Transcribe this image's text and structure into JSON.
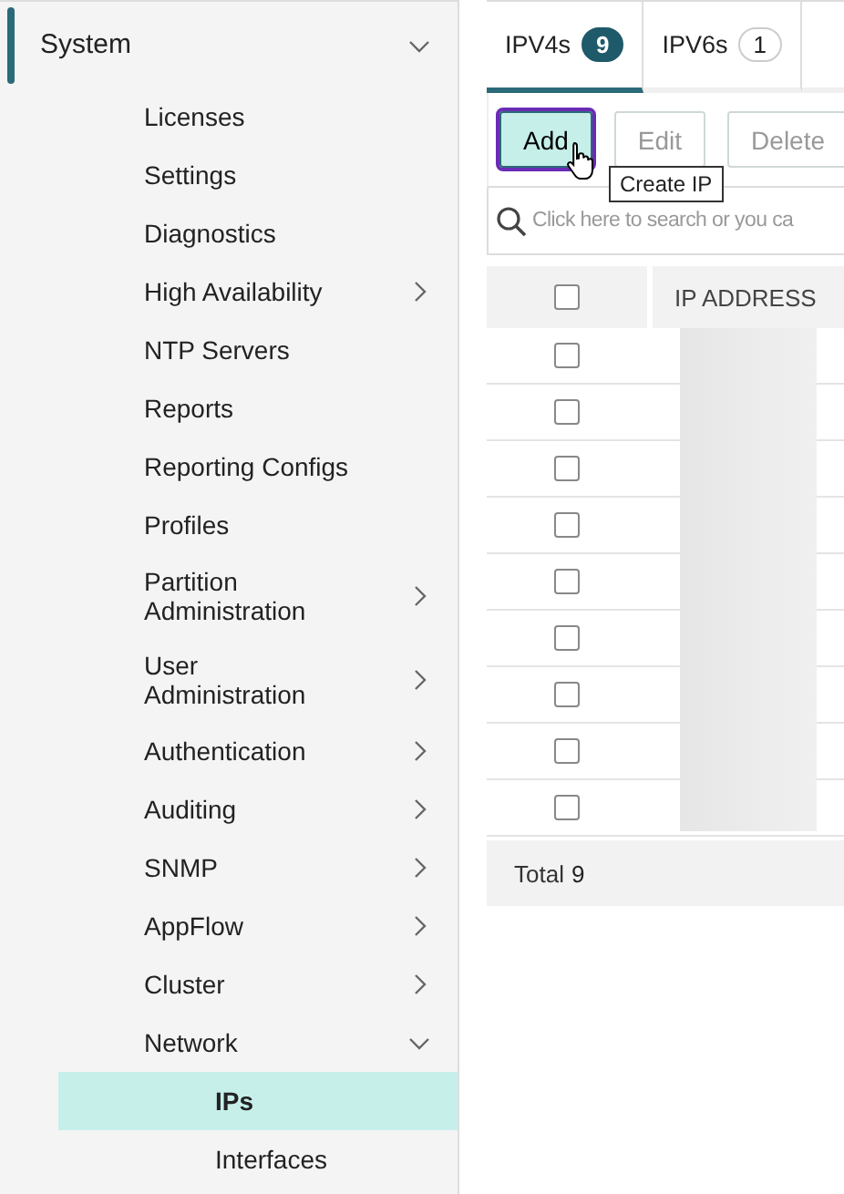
{
  "sidebar": {
    "section": {
      "label": "System",
      "expanded": true
    },
    "items": [
      {
        "label": "Licenses",
        "kind": "leaf"
      },
      {
        "label": "Settings",
        "kind": "leaf"
      },
      {
        "label": "Diagnostics",
        "kind": "leaf"
      },
      {
        "label": "High Availability",
        "kind": "group",
        "expanded": false
      },
      {
        "label": "NTP Servers",
        "kind": "leaf"
      },
      {
        "label": "Reports",
        "kind": "leaf"
      },
      {
        "label": "Reporting Configs",
        "kind": "leaf"
      },
      {
        "label": "Profiles",
        "kind": "leaf"
      },
      {
        "label": "Partition Administration",
        "kind": "group",
        "expanded": false
      },
      {
        "label": "User Administration",
        "kind": "group",
        "expanded": false
      },
      {
        "label": "Authentication",
        "kind": "group",
        "expanded": false
      },
      {
        "label": "Auditing",
        "kind": "group",
        "expanded": false
      },
      {
        "label": "SNMP",
        "kind": "group",
        "expanded": false
      },
      {
        "label": "AppFlow",
        "kind": "group",
        "expanded": false
      },
      {
        "label": "Cluster",
        "kind": "group",
        "expanded": false
      },
      {
        "label": "Network",
        "kind": "group",
        "expanded": true,
        "children": [
          {
            "label": "IPs",
            "selected": true
          },
          {
            "label": "Interfaces",
            "selected": false
          }
        ]
      }
    ]
  },
  "tabs": [
    {
      "label": "IPV4s",
      "count": "9",
      "selected": true
    },
    {
      "label": "IPV6s",
      "count": "1",
      "selected": false
    }
  ],
  "toolbar": [
    {
      "label": "Add",
      "disabled": false
    },
    {
      "label": "Edit",
      "disabled": true
    },
    {
      "label": "Delete",
      "disabled": true
    }
  ],
  "tooltip": "Create IP",
  "search": {
    "placeholder": "Click here to search or you ca"
  },
  "table": {
    "columns": [
      "IP ADDRESS"
    ],
    "header_checked": false,
    "rows": [
      {
        "checked": false
      },
      {
        "checked": false
      },
      {
        "checked": false
      },
      {
        "checked": false
      },
      {
        "checked": false
      },
      {
        "checked": false
      },
      {
        "checked": false
      },
      {
        "checked": false
      },
      {
        "checked": false
      }
    ],
    "footer": {
      "label": "Total",
      "count": "9"
    }
  }
}
